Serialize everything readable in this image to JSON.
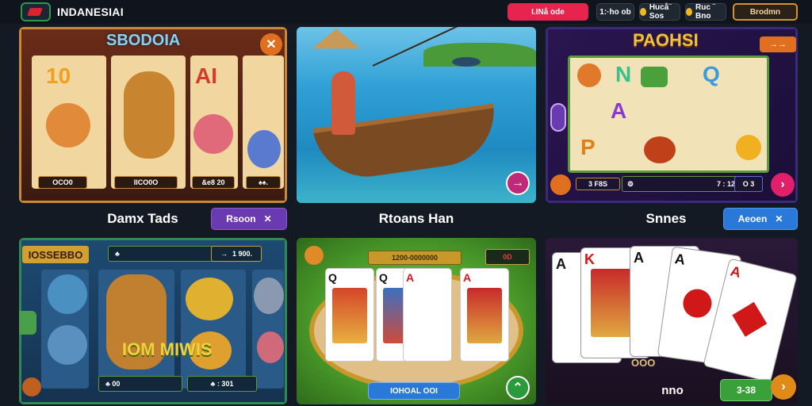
{
  "header": {
    "brand": "INDANESIAI",
    "pills": [
      "I.INå ode",
      "1:·ho ob",
      "Hucå¨ Sos",
      "Ruc ¨ Bno",
      "Brodmn"
    ]
  },
  "cards": [
    {
      "title": "SBODOIA",
      "reel_glyphs": [
        "10",
        "AI",
        "♠"
      ],
      "badges": [
        "OCO0",
        "IICO0O",
        "&e8 20",
        "♠♠."
      ],
      "corner": "✕"
    },
    {
      "arrow": "→"
    },
    {
      "title": "PAOHSI",
      "reel_glyphs": [
        "N",
        "Q",
        "A",
        "P"
      ],
      "badges": [
        "3 F8S",
        "⚙",
        "7 : 12",
        "O 3"
      ],
      "corner": "→→",
      "arrow": "›"
    },
    {
      "title": "IOSSEBBO",
      "badges": [
        "♣",
        "1 900.",
        "→",
        "♣ 00",
        "♣ : 301"
      ],
      "banner": "IOM MIWIS"
    },
    {
      "badges": [
        "1200-0000000",
        "0D"
      ],
      "button": "IOHOAL OOI",
      "arrow": "⌃"
    },
    {
      "banner": "OOO",
      "button": "3-38",
      "arrow": "›"
    }
  ],
  "labels": [
    "Damx Tads",
    "Rtoans Han",
    "Snnes",
    "nno"
  ],
  "buttons": [
    {
      "label": "Rsoon",
      "icon": "✕"
    },
    {
      "label": "Aeoen",
      "icon": "✕"
    }
  ],
  "colors": {
    "accent_red": "#e6244d",
    "accent_purple": "#6a3ab0",
    "accent_blue": "#2a78d8",
    "accent_gold": "#d9912a"
  }
}
